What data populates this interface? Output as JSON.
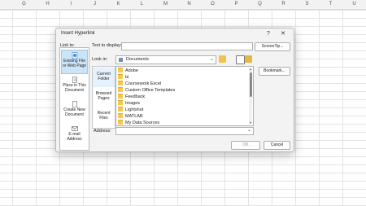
{
  "columns": [
    "G",
    "H",
    "I",
    "J",
    "K",
    "L",
    "M",
    "N",
    "O",
    "P",
    "Q",
    "R",
    "S",
    "T",
    "U"
  ],
  "dialog": {
    "title": "Insert Hyperlink",
    "help": "?",
    "close": "✕",
    "link_to_label": "Link to:",
    "text_to_display_label": "Text to display:",
    "text_to_display_value": "",
    "screentip_button": "ScreenTip...",
    "look_in_label": "Look in:",
    "look_in_value": "Documents",
    "bookmark_button": "Bookmark...",
    "address_label": "Address:",
    "address_value": "",
    "ok_button": "OK",
    "cancel_button": "Cancel",
    "link_to_items": [
      {
        "label": "Existing File or Web Page"
      },
      {
        "label": "Place in This Document"
      },
      {
        "label": "Create New Document"
      },
      {
        "label": "E-mail Address"
      }
    ],
    "places": [
      {
        "label": "Current Folder"
      },
      {
        "label": "Browsed Pages"
      },
      {
        "label": "Recent Files"
      }
    ],
    "files": [
      "Adobe",
      "bi",
      "Coursework Excel",
      "Custom Office Templates",
      "Feedback",
      "Images",
      "Lightshot",
      "MATLAB",
      "My Data Sources"
    ]
  }
}
